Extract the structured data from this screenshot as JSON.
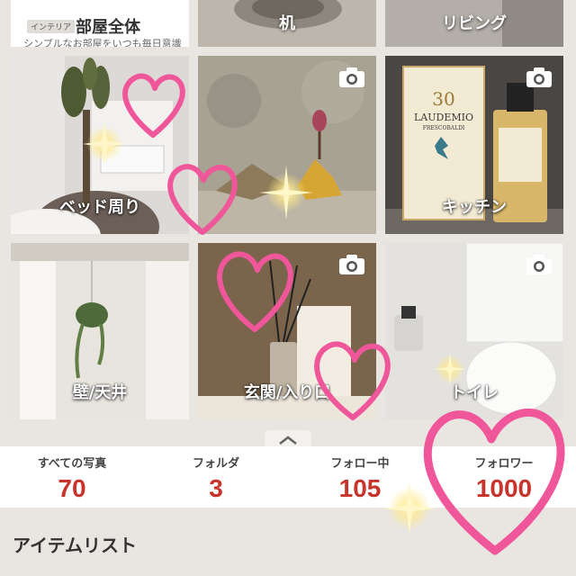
{
  "top_row": {
    "badge": "インテリア",
    "room_title": "部屋全体",
    "room_subtitle": "シンプルなお部屋をいつも毎日意識",
    "tile2_label": "机",
    "tile3_label": "リビング"
  },
  "grid": {
    "tiles": [
      {
        "label": "ベッド周り"
      },
      {
        "label": ""
      },
      {
        "label": "キッチン"
      },
      {
        "label": "壁/天井"
      },
      {
        "label": "玄関/入り口"
      },
      {
        "label": "トイレ"
      }
    ]
  },
  "product_text": {
    "brand": "LAUDEMIO",
    "sub": "FRESCOBALDI",
    "number": "30"
  },
  "stats": {
    "photos_label": "すべての写真",
    "photos_value": "70",
    "folders_label": "フォルダ",
    "folders_value": "3",
    "following_label": "フォロー中",
    "following_value": "105",
    "followers_label": "フォロワー",
    "followers_value": "1000"
  },
  "section": {
    "title": "アイテムリスト"
  },
  "colors": {
    "accent_red": "#c8342b",
    "heart_pink": "#f0569a",
    "background": "#e9e6e1"
  },
  "icons": [
    "camera-icon",
    "chevron-up-icon",
    "heart-icon",
    "sparkle-icon"
  ]
}
